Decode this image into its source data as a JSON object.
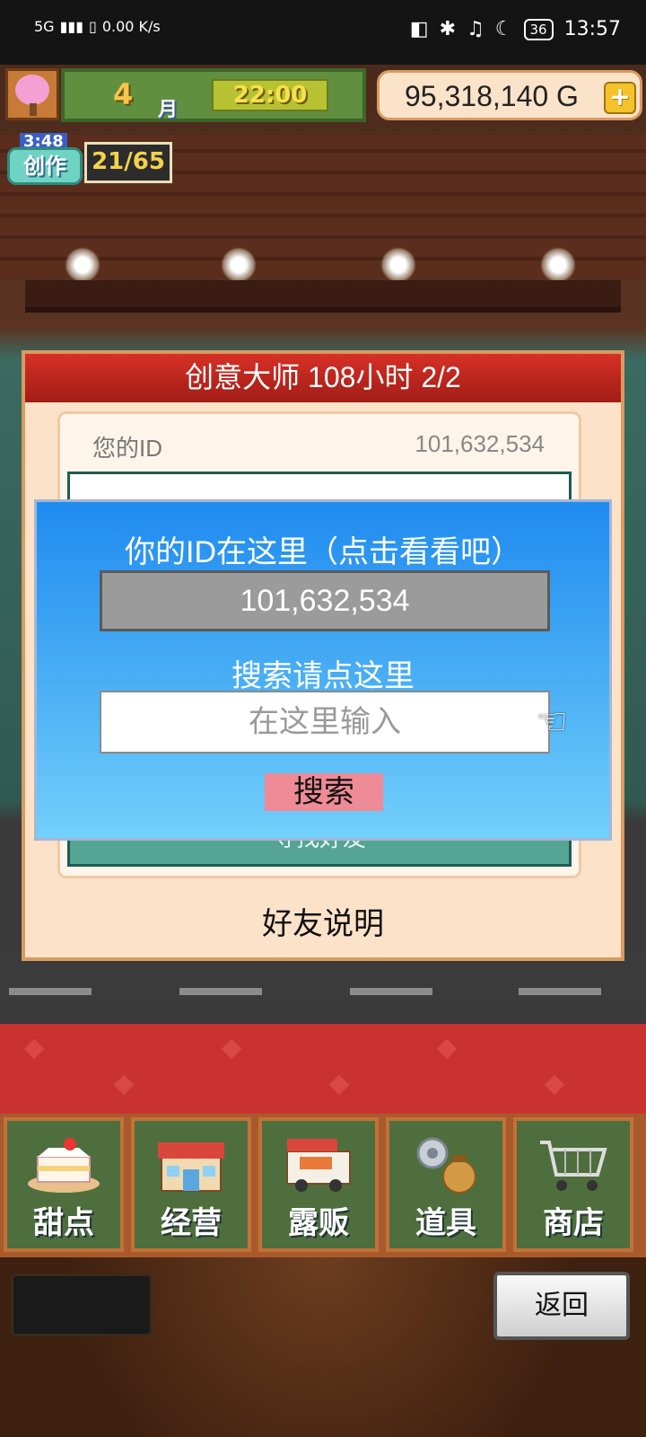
{
  "status_bar": {
    "network": "5G",
    "speed": "0.00 K/s",
    "battery": "36",
    "time": "13:57"
  },
  "hud": {
    "month_number": "4",
    "month_label": "月",
    "clock": "22:00",
    "money": "95,318,140 G",
    "create_timer": "3:48",
    "create_label": "创作",
    "create_count": "21/65"
  },
  "panel": {
    "title": "创意大师  108小时 2/2",
    "your_id_label": "您的ID",
    "your_id_value": "101,632,534",
    "find_friend_button": "寻找好友",
    "friend_explanation": "好友说明"
  },
  "dialog": {
    "title": "你的ID在这里（点击看看吧）",
    "id_value": "101,632,534",
    "search_hint": "搜索请点这里",
    "input_placeholder": "在这里输入",
    "search_button": "搜索"
  },
  "nav": {
    "tabs": [
      {
        "label": "甜点",
        "icon": "cake-icon"
      },
      {
        "label": "经营",
        "icon": "shop-icon"
      },
      {
        "label": "露贩",
        "icon": "food-truck-icon"
      },
      {
        "label": "道具",
        "icon": "items-icon"
      },
      {
        "label": "商店",
        "icon": "cart-icon"
      }
    ],
    "back_button": "返回"
  },
  "colors": {
    "dialog_top": "#1f8bf0",
    "dialog_bottom": "#72d0fb",
    "panel_header": "#d63026",
    "search_button": "#ef8b97",
    "nav_tab": "#4f6e3e"
  }
}
